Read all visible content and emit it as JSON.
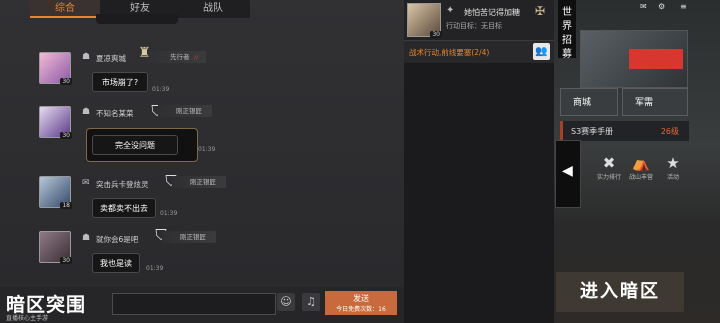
{
  "tabs": [
    "综合",
    "好友",
    "战队"
  ],
  "messages": [
    {
      "name": "夏凉爽城",
      "badge": "先行者",
      "text": "市场崩了?",
      "time": "01:39",
      "level": "30"
    },
    {
      "name": "不知名某菜",
      "badge": "刚正银匠",
      "text": "完全没问题",
      "time": "01:39",
      "level": "30"
    },
    {
      "name": "突击兵卡登炫灵",
      "badge": "刚正银匠",
      "text": "卖都卖不出去",
      "time": "01:39",
      "level": "18"
    },
    {
      "name": "就你会6是吧",
      "badge": "刚正银匠",
      "text": "我也是读",
      "time": "01:39",
      "level": "30"
    }
  ],
  "input": {
    "placeholder": ""
  },
  "send": {
    "label": "发送",
    "sub": "今日免费次数：16"
  },
  "logo": {
    "title": "暗区突围",
    "sub": "直播核心主手游"
  },
  "team": {
    "name": "她怕苦记得加糖",
    "goal": "行动目标：无目标",
    "level": "30",
    "mission": "战术行动,前线要塞(2/4)"
  },
  "world": {
    "tab": "世界招募",
    "shop": "商城",
    "warehouse": "军需",
    "season": "S3赛季手册",
    "season_level": "26级",
    "icons": [
      "实力排行",
      "战山丰营",
      "活动"
    ],
    "enter": "进入暗区"
  },
  "colors": {
    "accent": "#e8862f",
    "send": "#c86a3b"
  }
}
